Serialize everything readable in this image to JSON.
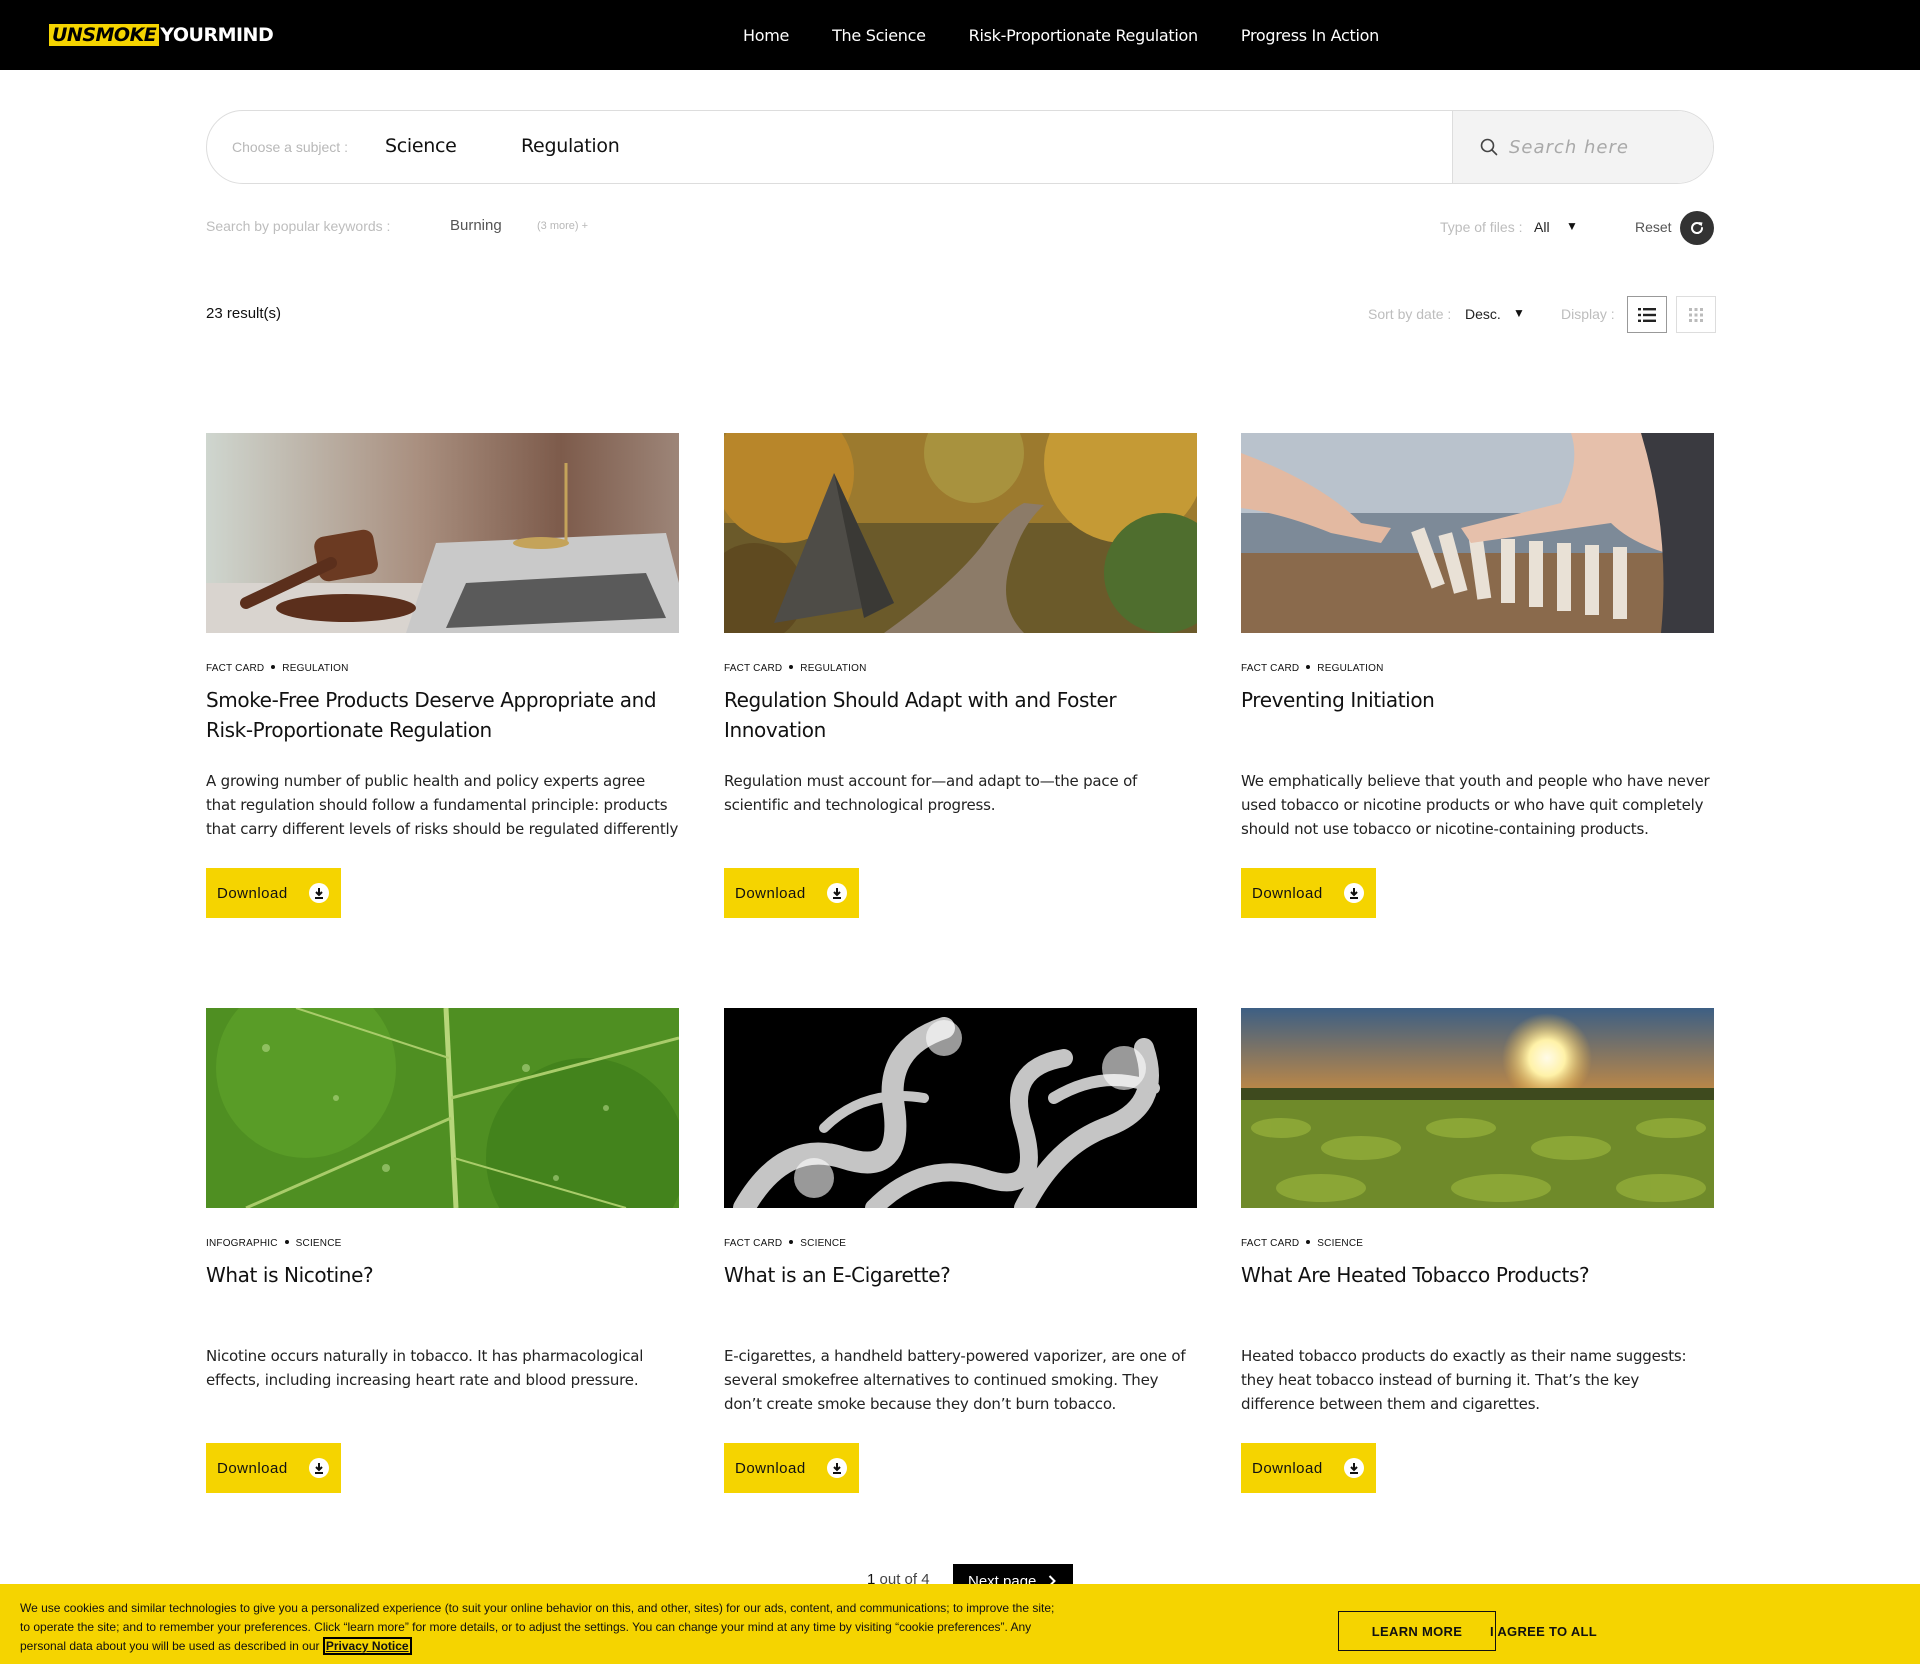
{
  "header": {
    "logo_un": "UNSMOKE",
    "logo_rest": "YOURMIND",
    "nav": [
      "Home",
      "The Science",
      "Risk-Proportionate Regulation",
      "Progress In Action"
    ]
  },
  "search": {
    "subject_label": "Choose a subject :",
    "subjects": [
      "Science",
      "Regulation"
    ],
    "placeholder": "Search here"
  },
  "filters": {
    "keywords_label": "Search by popular keywords :",
    "keyword": "Burning",
    "more": "(3 more) +",
    "file_type_label": "Type of files :",
    "file_type_value": "All",
    "reset_label": "Reset"
  },
  "results_bar": {
    "count": "23",
    "count_suffix": " result(s)",
    "sort_label": "Sort by date :",
    "sort_value": "Desc.",
    "display_label": "Display :"
  },
  "cards": [
    {
      "type": "FACT CARD",
      "subject": "REGULATION",
      "title": "Smoke-Free Products Deserve Appropriate and Risk-Proportionate Regulation",
      "text": "A growing number of public health and policy experts agree that regulation should follow a fundamental principle: products that carry different levels of risks should be regulated differently and in...",
      "button": "Download",
      "image": "gavel-and-laptop"
    },
    {
      "type": "FACT CARD",
      "subject": "REGULATION",
      "title": "Regulation Should Adapt with and Foster Innovation",
      "text": "Regulation must account for—and adapt to—the pace of scientific and technological progress.",
      "button": "Download",
      "image": "autumn-forest-road"
    },
    {
      "type": "FACT CARD",
      "subject": "REGULATION",
      "title": "Preventing Initiation",
      "text": "We emphatically believe that youth and people who have never used tobacco or nicotine products or who have quit completely should not use tobacco or nicotine-containing products.",
      "button": "Download",
      "image": "hands-stopping-dominoes"
    },
    {
      "type": "INFOGRAPHIC",
      "subject": "SCIENCE",
      "title": "What is Nicotine?",
      "text": "Nicotine occurs naturally in tobacco. It has pharmacological effects, including increasing heart rate and blood pressure.",
      "button": "Download",
      "image": "green-leaf-with-droplets"
    },
    {
      "type": "FACT CARD",
      "subject": "SCIENCE",
      "title": "What is an E-Cigarette?",
      "text": "E-cigarettes, a handheld battery-powered vaporizer, are one of several smokefree alternatives to continued smoking. They don’t create smoke because they don’t burn tobacco.",
      "button": "Download",
      "image": "white-smoke-on-black"
    },
    {
      "type": "FACT CARD",
      "subject": "SCIENCE",
      "title": "What Are Heated Tobacco Products?",
      "text": "Heated tobacco products do exactly as their name suggests: they heat tobacco instead of burning it. That’s the key difference between them and cigarettes.",
      "button": "Download",
      "image": "tobacco-field-sunset"
    }
  ],
  "pagination": {
    "current": "1",
    "of": " out of 4",
    "next": "Next page"
  },
  "cookie": {
    "text": "We use cookies and similar technologies to give you a personalized experience (to suit your online behavior on this, and other, sites) for our ads, content, and communications; to improve the site; to operate the site; and to remember your preferences. Click “learn more” for more details, or to adjust the settings. You can change your mind at any time by visiting “cookie preferences”. Any personal data about you will be used as described in our ",
    "link": "Privacy Notice",
    "learn_more": "LEARN MORE",
    "agree": "I AGREE TO ALL"
  },
  "colors": {
    "accent": "#f5d400",
    "header_bg": "#000000"
  }
}
